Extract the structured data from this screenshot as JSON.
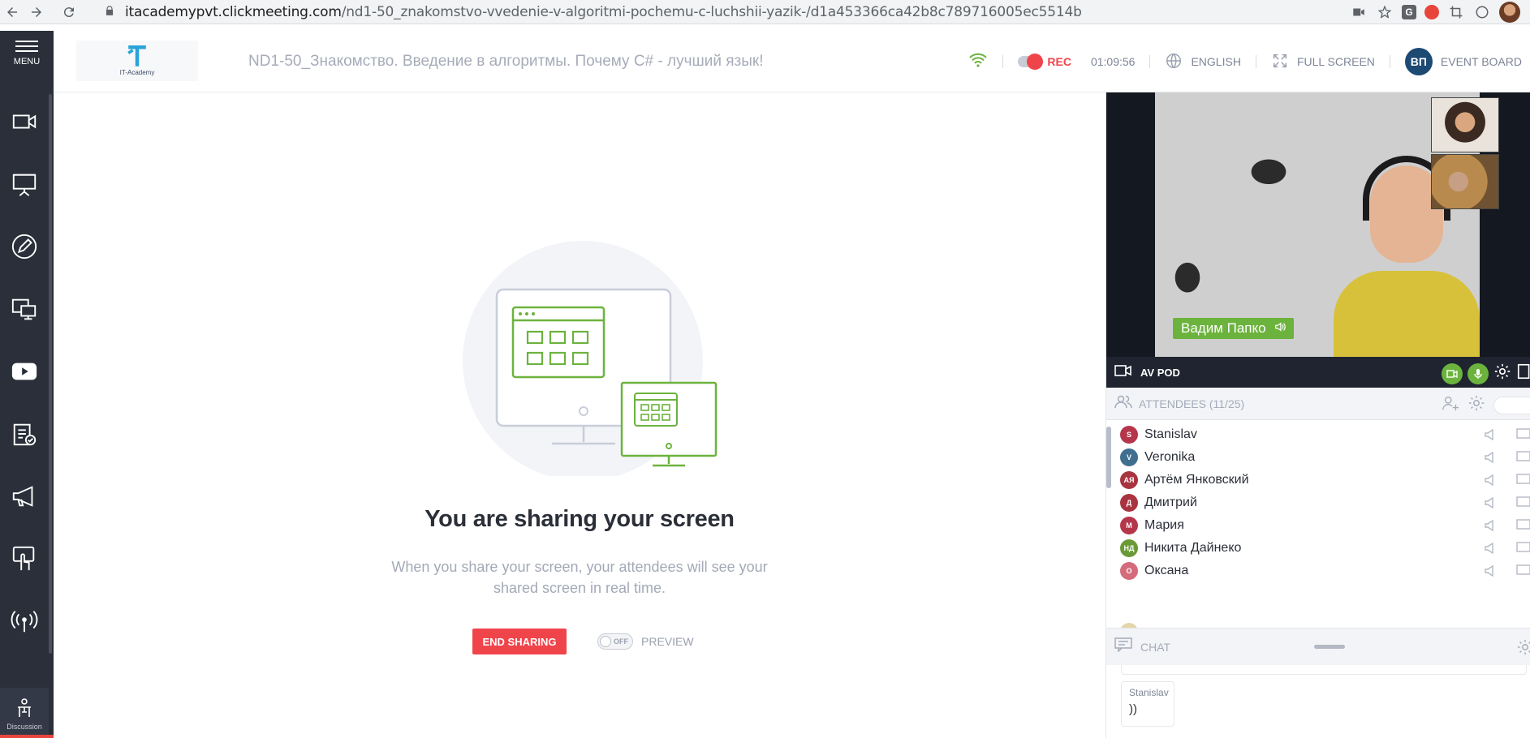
{
  "browser": {
    "url_host": "itacademypvt.clickmeeting.com",
    "url_path": "/nd1-50_znakomstvo-vvedenie-v-algoritmi-pochemu-c-luchshii-yazik-/d1a453366ca42b8c789716005ec5514b"
  },
  "sidebar": {
    "menu_label": "MENU",
    "discussion_label": "Discussion"
  },
  "header": {
    "logo_text": "IT-Academy",
    "title": "ND1-50_Знакомство. Введение в алгоритмы. Почему C# - лучший язык!",
    "rec_label": "REC",
    "rec_time": "01:09:56",
    "language": "ENGLISH",
    "fullscreen": "FULL SCREEN",
    "user_initials": "ВП",
    "event_board": "EVENT BOARD"
  },
  "stage": {
    "title": "You are sharing your screen",
    "desc_line1": "When you share your screen, your attendees will see your",
    "desc_line2": "shared screen in real time.",
    "end_button": "END SHARING",
    "preview_toggle": "OFF",
    "preview_label": "PREVIEW"
  },
  "av": {
    "presenter_name": "Вадим Папко",
    "label": "AV POD"
  },
  "attendees": {
    "title": "ATTENDEES (11/25)",
    "list": [
      {
        "initials": "S",
        "name": "Stanislav",
        "color": "#b5364a"
      },
      {
        "initials": "V",
        "name": "Veronika",
        "color": "#3f6e8f"
      },
      {
        "initials": "АЯ",
        "name": "Артём Янковский",
        "color": "#a8343f"
      },
      {
        "initials": "Д",
        "name": "Дмитрий",
        "color": "#a8343f"
      },
      {
        "initials": "М",
        "name": "Мария",
        "color": "#b5364a"
      },
      {
        "initials": "НД",
        "name": "Никита Дайнеко",
        "color": "#6a9a35"
      },
      {
        "initials": "О",
        "name": "Оксана",
        "color": "#d46b7a"
      }
    ]
  },
  "chat": {
    "title": "CHAT",
    "message_author": "Stanislav",
    "message_text": "))"
  },
  "colors": {
    "accent_red": "#f0444b",
    "accent_green": "#6cb33e",
    "sidebar_bg": "#2a2f3a"
  }
}
